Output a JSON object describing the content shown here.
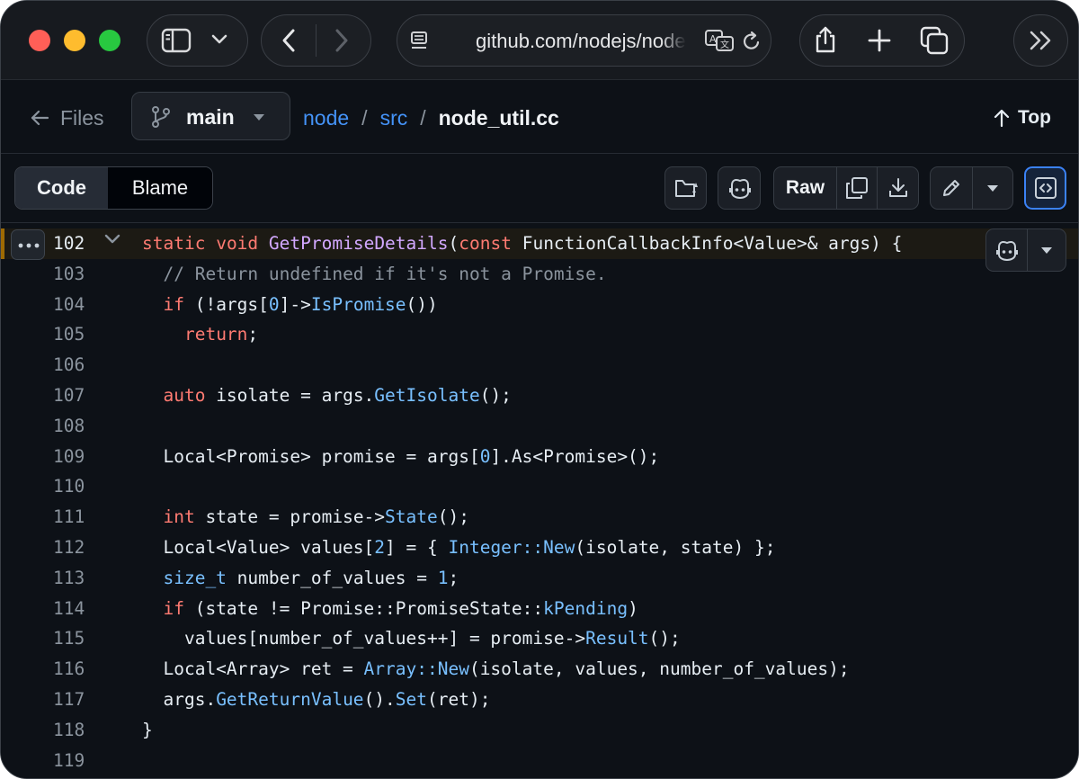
{
  "browser": {
    "url": "github.com/nodejs/node/blob/main/src/node_util.cc"
  },
  "file_header": {
    "files_label": "Files",
    "branch": "main",
    "breadcrumb": [
      "node",
      "src"
    ],
    "separator": "/",
    "current_file": "node_util.cc",
    "top_label": "Top"
  },
  "code_toolbar": {
    "tabs": [
      "Code",
      "Blame"
    ],
    "active_tab": "Code",
    "raw_label": "Raw"
  },
  "code": {
    "highlighted_line": 102,
    "lines": [
      {
        "n": "102",
        "tokens": [
          [
            "kw",
            "static"
          ],
          [
            "pl",
            " "
          ],
          [
            "kw",
            "void"
          ],
          [
            "pl",
            " "
          ],
          [
            "fn",
            "GetPromiseDetails"
          ],
          [
            "pl",
            "("
          ],
          [
            "kw",
            "const"
          ],
          [
            "pl",
            " FunctionCallbackInfo<Value>& args) {"
          ]
        ]
      },
      {
        "n": "103",
        "tokens": [
          [
            "pl",
            "  "
          ],
          [
            "cm",
            "// Return undefined if it's not a Promise."
          ]
        ]
      },
      {
        "n": "104",
        "tokens": [
          [
            "pl",
            "  "
          ],
          [
            "kw",
            "if"
          ],
          [
            "pl",
            " (!args["
          ],
          [
            "num",
            "0"
          ],
          [
            "pl",
            "]->"
          ],
          [
            "call",
            "IsPromise"
          ],
          [
            "pl",
            "())"
          ]
        ]
      },
      {
        "n": "105",
        "tokens": [
          [
            "pl",
            "    "
          ],
          [
            "kw",
            "return"
          ],
          [
            "pl",
            ";"
          ]
        ]
      },
      {
        "n": "106",
        "tokens": []
      },
      {
        "n": "107",
        "tokens": [
          [
            "pl",
            "  "
          ],
          [
            "kw",
            "auto"
          ],
          [
            "pl",
            " isolate = args."
          ],
          [
            "call",
            "GetIsolate"
          ],
          [
            "pl",
            "();"
          ]
        ]
      },
      {
        "n": "108",
        "tokens": []
      },
      {
        "n": "109",
        "tokens": [
          [
            "pl",
            "  Local<Promise> promise = args["
          ],
          [
            "num",
            "0"
          ],
          [
            "pl",
            "].As<Promise>();"
          ]
        ]
      },
      {
        "n": "110",
        "tokens": []
      },
      {
        "n": "111",
        "tokens": [
          [
            "pl",
            "  "
          ],
          [
            "kw",
            "int"
          ],
          [
            "pl",
            " state = promise->"
          ],
          [
            "call",
            "State"
          ],
          [
            "pl",
            "();"
          ]
        ]
      },
      {
        "n": "112",
        "tokens": [
          [
            "pl",
            "  Local<Value> values["
          ],
          [
            "num",
            "2"
          ],
          [
            "pl",
            "] = { "
          ],
          [
            "call",
            "Integer::New"
          ],
          [
            "pl",
            "(isolate, state) };"
          ]
        ]
      },
      {
        "n": "113",
        "tokens": [
          [
            "pl",
            "  "
          ],
          [
            "call",
            "size_t"
          ],
          [
            "pl",
            " number_of_values = "
          ],
          [
            "num",
            "1"
          ],
          [
            "pl",
            ";"
          ]
        ]
      },
      {
        "n": "114",
        "tokens": [
          [
            "pl",
            "  "
          ],
          [
            "kw",
            "if"
          ],
          [
            "pl",
            " (state != Promise::PromiseState::"
          ],
          [
            "call",
            "kPending"
          ],
          [
            "pl",
            ")"
          ]
        ]
      },
      {
        "n": "115",
        "tokens": [
          [
            "pl",
            "    values[number_of_values++] = promise->"
          ],
          [
            "call",
            "Result"
          ],
          [
            "pl",
            "();"
          ]
        ]
      },
      {
        "n": "116",
        "tokens": [
          [
            "pl",
            "  Local<Array> ret = "
          ],
          [
            "call",
            "Array::New"
          ],
          [
            "pl",
            "(isolate, values, number_of_values);"
          ]
        ]
      },
      {
        "n": "117",
        "tokens": [
          [
            "pl",
            "  args."
          ],
          [
            "call",
            "GetReturnValue"
          ],
          [
            "pl",
            "()."
          ],
          [
            "call",
            "Set"
          ],
          [
            "pl",
            "(ret);"
          ]
        ]
      },
      {
        "n": "118",
        "tokens": [
          [
            "pl",
            "}"
          ]
        ]
      },
      {
        "n": "119",
        "tokens": []
      }
    ]
  },
  "colors": {
    "keyword": "#ff7b72",
    "function": "#d2a8ff",
    "call": "#79c0ff",
    "comment": "#8b949e",
    "link": "#4493f8",
    "active_border": "#3b82f6"
  },
  "icons": [
    "sidebar-icon",
    "chevron-down-icon",
    "back-arrow-icon",
    "forward-arrow-icon",
    "reader-icon",
    "translate-icon",
    "reload-icon",
    "share-icon",
    "plus-icon",
    "tabs-icon",
    "chevrons-right-icon",
    "arrow-left-icon",
    "git-branch-icon",
    "arrow-up-icon",
    "file-directory-icon",
    "copilot-icon",
    "copy-icon",
    "download-icon",
    "pencil-icon",
    "code-square-icon",
    "kebab-icon"
  ]
}
